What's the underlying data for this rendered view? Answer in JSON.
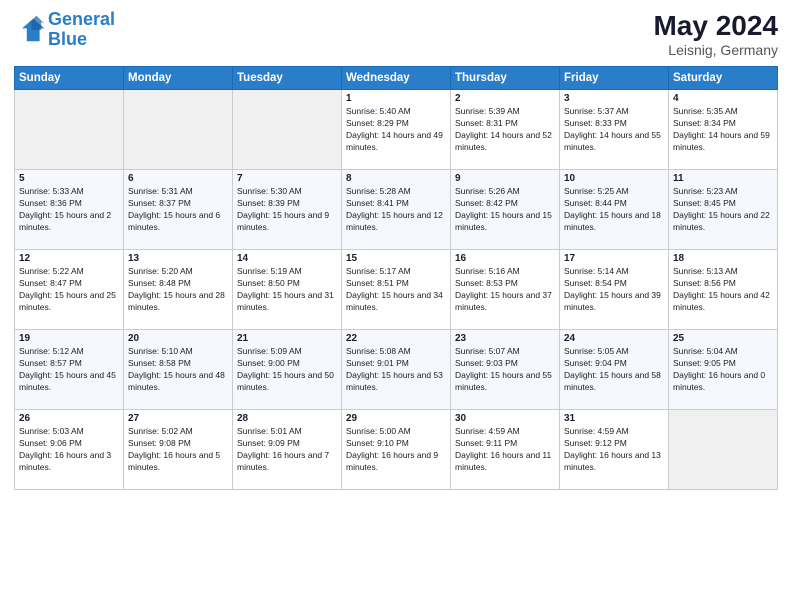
{
  "header": {
    "logo_line1": "General",
    "logo_line2": "Blue",
    "month": "May 2024",
    "location": "Leisnig, Germany"
  },
  "weekdays": [
    "Sunday",
    "Monday",
    "Tuesday",
    "Wednesday",
    "Thursday",
    "Friday",
    "Saturday"
  ],
  "weeks": [
    [
      {
        "day": "",
        "empty": true
      },
      {
        "day": "",
        "empty": true
      },
      {
        "day": "",
        "empty": true
      },
      {
        "day": "1",
        "sunrise": "5:40 AM",
        "sunset": "8:29 PM",
        "daylight": "14 hours and 49 minutes."
      },
      {
        "day": "2",
        "sunrise": "5:39 AM",
        "sunset": "8:31 PM",
        "daylight": "14 hours and 52 minutes."
      },
      {
        "day": "3",
        "sunrise": "5:37 AM",
        "sunset": "8:33 PM",
        "daylight": "14 hours and 55 minutes."
      },
      {
        "day": "4",
        "sunrise": "5:35 AM",
        "sunset": "8:34 PM",
        "daylight": "14 hours and 59 minutes."
      }
    ],
    [
      {
        "day": "5",
        "sunrise": "5:33 AM",
        "sunset": "8:36 PM",
        "daylight": "15 hours and 2 minutes."
      },
      {
        "day": "6",
        "sunrise": "5:31 AM",
        "sunset": "8:37 PM",
        "daylight": "15 hours and 6 minutes."
      },
      {
        "day": "7",
        "sunrise": "5:30 AM",
        "sunset": "8:39 PM",
        "daylight": "15 hours and 9 minutes."
      },
      {
        "day": "8",
        "sunrise": "5:28 AM",
        "sunset": "8:41 PM",
        "daylight": "15 hours and 12 minutes."
      },
      {
        "day": "9",
        "sunrise": "5:26 AM",
        "sunset": "8:42 PM",
        "daylight": "15 hours and 15 minutes."
      },
      {
        "day": "10",
        "sunrise": "5:25 AM",
        "sunset": "8:44 PM",
        "daylight": "15 hours and 18 minutes."
      },
      {
        "day": "11",
        "sunrise": "5:23 AM",
        "sunset": "8:45 PM",
        "daylight": "15 hours and 22 minutes."
      }
    ],
    [
      {
        "day": "12",
        "sunrise": "5:22 AM",
        "sunset": "8:47 PM",
        "daylight": "15 hours and 25 minutes."
      },
      {
        "day": "13",
        "sunrise": "5:20 AM",
        "sunset": "8:48 PM",
        "daylight": "15 hours and 28 minutes."
      },
      {
        "day": "14",
        "sunrise": "5:19 AM",
        "sunset": "8:50 PM",
        "daylight": "15 hours and 31 minutes."
      },
      {
        "day": "15",
        "sunrise": "5:17 AM",
        "sunset": "8:51 PM",
        "daylight": "15 hours and 34 minutes."
      },
      {
        "day": "16",
        "sunrise": "5:16 AM",
        "sunset": "8:53 PM",
        "daylight": "15 hours and 37 minutes."
      },
      {
        "day": "17",
        "sunrise": "5:14 AM",
        "sunset": "8:54 PM",
        "daylight": "15 hours and 39 minutes."
      },
      {
        "day": "18",
        "sunrise": "5:13 AM",
        "sunset": "8:56 PM",
        "daylight": "15 hours and 42 minutes."
      }
    ],
    [
      {
        "day": "19",
        "sunrise": "5:12 AM",
        "sunset": "8:57 PM",
        "daylight": "15 hours and 45 minutes."
      },
      {
        "day": "20",
        "sunrise": "5:10 AM",
        "sunset": "8:58 PM",
        "daylight": "15 hours and 48 minutes."
      },
      {
        "day": "21",
        "sunrise": "5:09 AM",
        "sunset": "9:00 PM",
        "daylight": "15 hours and 50 minutes."
      },
      {
        "day": "22",
        "sunrise": "5:08 AM",
        "sunset": "9:01 PM",
        "daylight": "15 hours and 53 minutes."
      },
      {
        "day": "23",
        "sunrise": "5:07 AM",
        "sunset": "9:03 PM",
        "daylight": "15 hours and 55 minutes."
      },
      {
        "day": "24",
        "sunrise": "5:05 AM",
        "sunset": "9:04 PM",
        "daylight": "15 hours and 58 minutes."
      },
      {
        "day": "25",
        "sunrise": "5:04 AM",
        "sunset": "9:05 PM",
        "daylight": "16 hours and 0 minutes."
      }
    ],
    [
      {
        "day": "26",
        "sunrise": "5:03 AM",
        "sunset": "9:06 PM",
        "daylight": "16 hours and 3 minutes."
      },
      {
        "day": "27",
        "sunrise": "5:02 AM",
        "sunset": "9:08 PM",
        "daylight": "16 hours and 5 minutes."
      },
      {
        "day": "28",
        "sunrise": "5:01 AM",
        "sunset": "9:09 PM",
        "daylight": "16 hours and 7 minutes."
      },
      {
        "day": "29",
        "sunrise": "5:00 AM",
        "sunset": "9:10 PM",
        "daylight": "16 hours and 9 minutes."
      },
      {
        "day": "30",
        "sunrise": "4:59 AM",
        "sunset": "9:11 PM",
        "daylight": "16 hours and 11 minutes."
      },
      {
        "day": "31",
        "sunrise": "4:59 AM",
        "sunset": "9:12 PM",
        "daylight": "16 hours and 13 minutes."
      },
      {
        "day": "",
        "empty": true
      }
    ]
  ]
}
